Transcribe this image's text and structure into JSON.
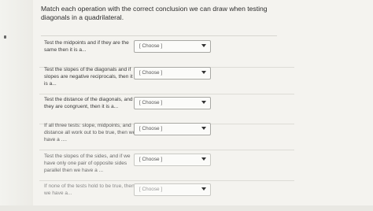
{
  "question": "Match each operation with the correct conclusion we can draw when testing diagonals in a quadrilateral.",
  "rows": [
    {
      "label": "Test the midpoints and if they are the same then it is a...",
      "value": "[ Choose ]"
    },
    {
      "label": "Test the slopes of the diagonals and if slopes are negative reciprocals, then it is a...",
      "value": "[ Choose ]"
    },
    {
      "label": "Test the distance of the diagonals, and if they are congruent, then it is a...",
      "value": "[ Choose ]"
    },
    {
      "label": "If all three tests: slope, midpoints, and distance all work out to be true, then we have a ....",
      "value": "[ Choose ]"
    },
    {
      "label": "Test the slopes of the sides, and if we have only one pair of opposite sides parallel then we have a ...",
      "value": "[ Choose ]"
    },
    {
      "label": "If none of the tests hold to be true, then we have a...",
      "value": "[ Choose ]"
    }
  ]
}
